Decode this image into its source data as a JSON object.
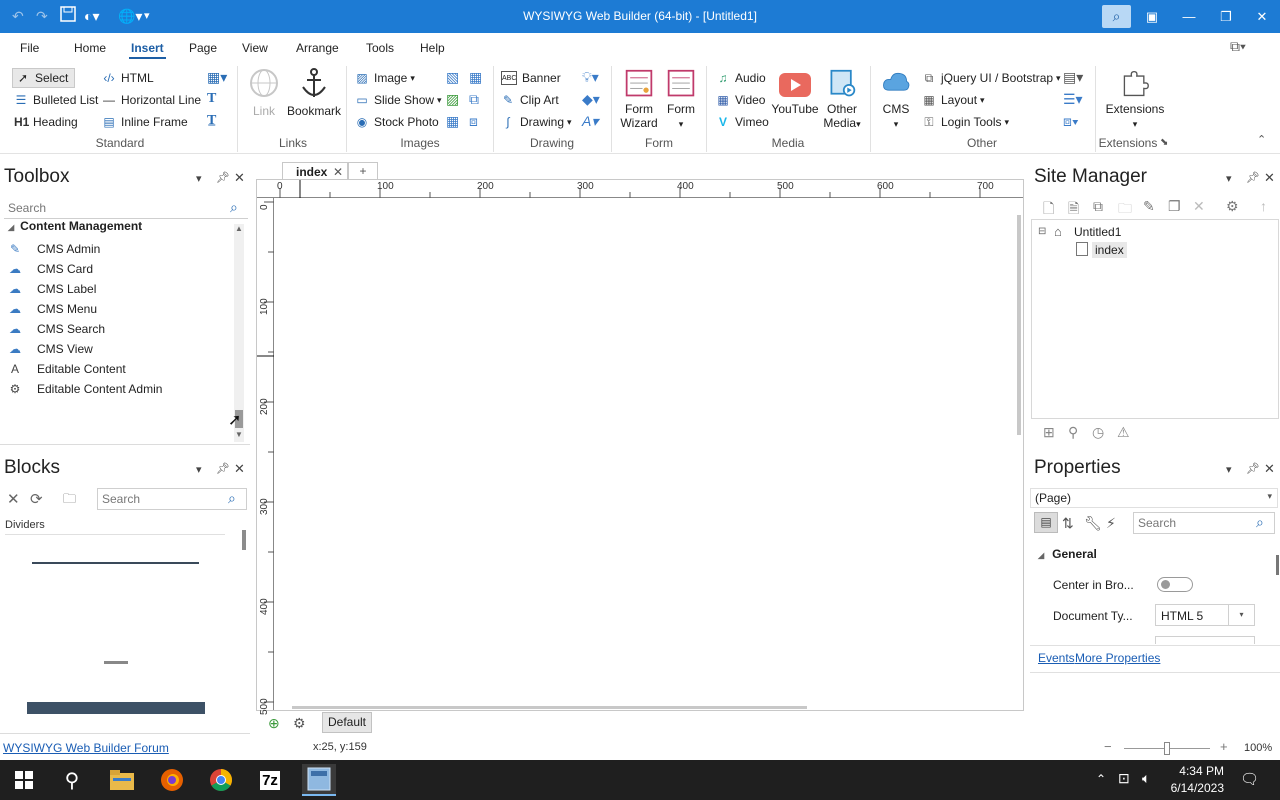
{
  "window": {
    "title": "WYSIWYG Web Builder (64-bit) - [Untitled1]"
  },
  "menu": {
    "items": [
      "File",
      "Home",
      "Insert",
      "Page",
      "View",
      "Arrange",
      "Tools",
      "Help"
    ],
    "active": "Insert"
  },
  "ribbon": {
    "standard": {
      "select": "Select",
      "html": "HTML",
      "bulleted_list": "Bulleted List",
      "horizontal_line": "Horizontal Line",
      "heading": "Heading",
      "inline_frame": "Inline Frame",
      "group": "Standard"
    },
    "links": {
      "link": "Link",
      "bookmark": "Bookmark",
      "group": "Links"
    },
    "images": {
      "image": "Image",
      "slide_show": "Slide Show",
      "stock_photo": "Stock Photo",
      "group": "Images"
    },
    "drawing": {
      "banner": "Banner",
      "clip_art": "Clip Art",
      "drawing": "Drawing",
      "group": "Drawing"
    },
    "form": {
      "form_wizard_1": "Form",
      "form_wizard_2": "Wizard",
      "form": "Form",
      "group": "Form"
    },
    "media": {
      "audio": "Audio",
      "video": "Video",
      "vimeo": "Vimeo",
      "youtube": "YouTube",
      "other_media_1": "Other",
      "other_media_2": "Media",
      "group": "Media"
    },
    "other": {
      "cms": "CMS",
      "jquery": "jQuery UI / Bootstrap",
      "layout": "Layout",
      "login_tools": "Login Tools",
      "group": "Other"
    },
    "extensions": {
      "label": "Extensions",
      "group": "Extensions"
    }
  },
  "toolbox": {
    "title": "Toolbox",
    "search_placeholder": "Search",
    "category": "Content Management",
    "items": [
      "CMS Admin",
      "CMS Card",
      "CMS Label",
      "CMS Menu",
      "CMS Search",
      "CMS View",
      "Editable Content",
      "Editable Content Admin"
    ]
  },
  "blocks": {
    "title": "Blocks",
    "search_placeholder": "Search",
    "category": "Dividers"
  },
  "editor": {
    "tab": "index",
    "add_tab": "+",
    "ruler_h": [
      "0",
      "100",
      "200",
      "300",
      "400",
      "500",
      "600",
      "700"
    ],
    "ruler_v": [
      "0",
      "100",
      "200",
      "300",
      "400",
      "500"
    ],
    "master_label": "Default"
  },
  "site_manager": {
    "title": "Site Manager",
    "root": "Untitled1",
    "page": "index"
  },
  "properties": {
    "title": "Properties",
    "selector": "(Page)",
    "search_placeholder": "Search",
    "section": "General",
    "rows": [
      {
        "label": "Center in Bro...",
        "type": "toggle"
      },
      {
        "label": "Document Ty...",
        "value": "HTML 5"
      }
    ],
    "links": [
      "Events",
      "More Properties"
    ]
  },
  "status": {
    "forum_link": "WYSIWYG Web Builder Forum",
    "coords": "x:25, y:159",
    "zoom": "100%"
  },
  "taskbar": {
    "time": "4:34 PM",
    "date": "6/14/2023"
  }
}
